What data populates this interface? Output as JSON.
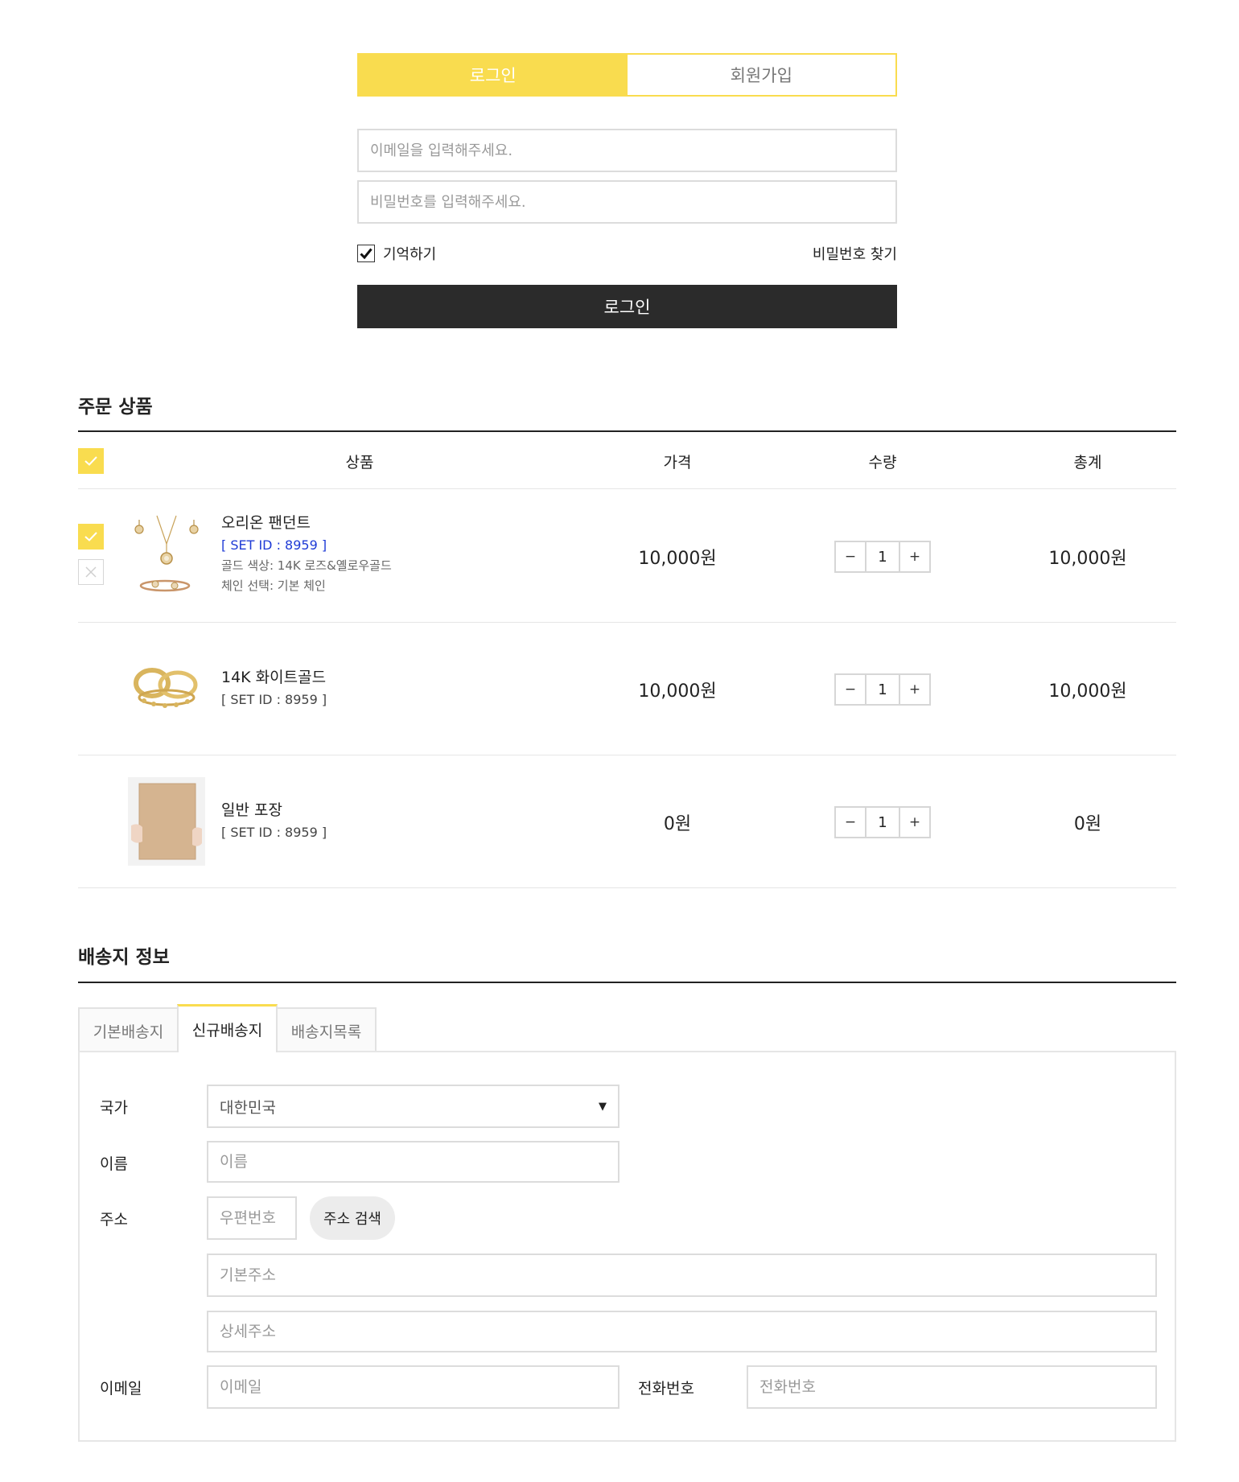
{
  "login": {
    "tab_login": "로그인",
    "tab_signup": "회원가입",
    "email_placeholder": "이메일을 입력해주세요.",
    "password_placeholder": "비밀번호를 입력해주세요.",
    "remember_label": "기억하기",
    "remember_checked": true,
    "forgot_label": "비밀번호 찾기",
    "login_button": "로그인"
  },
  "order": {
    "title": "주문 상품",
    "columns": {
      "product": "상품",
      "price": "가격",
      "quantity": "수량",
      "total": "총계"
    },
    "items": [
      {
        "name": "오리온 팬던트",
        "set_id": "[ SET ID : 8959 ]",
        "options": [
          "골드 색상: 14K 로즈&옐로우골드",
          "체인 선택: 기본 체인"
        ],
        "price": "10,000원",
        "quantity": "1",
        "total": "10,000원",
        "image_icon": "pendant-image"
      },
      {
        "name": "14K 화이트골드",
        "set_id": "[ SET ID : 8959 ]",
        "price": "10,000원",
        "quantity": "1",
        "total": "10,000원",
        "image_icon": "rings-image"
      },
      {
        "name": "일반 포장",
        "set_id": "[ SET ID : 8959 ]",
        "price": "0원",
        "quantity": "1",
        "total": "0원",
        "image_icon": "box-image"
      }
    ],
    "qty_minus": "−",
    "qty_plus": "+"
  },
  "shipping": {
    "title": "배송지 정보",
    "tabs": [
      "기본배송지",
      "신규배송지",
      "배송지목록"
    ],
    "active_tab": 1,
    "labels": {
      "country": "국가",
      "name": "이름",
      "address": "주소",
      "email": "이메일",
      "phone": "전화번호"
    },
    "country_value": "대한민국",
    "placeholders": {
      "name": "이름",
      "zipcode": "우편번호",
      "base_address": "기본주소",
      "detail_address": "상세주소",
      "email": "이메일",
      "phone": "전화번호"
    },
    "address_search_button": "주소 검색"
  },
  "colors": {
    "accent_yellow": "#f9dc4f",
    "dark_button": "#2b2b2b",
    "set_id_blue": "#1f3bd6"
  }
}
